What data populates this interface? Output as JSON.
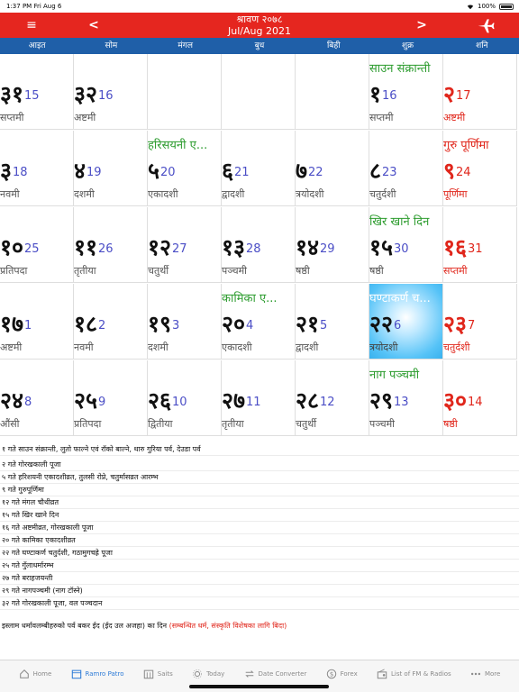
{
  "status_bar": {
    "time": "1:37 PM",
    "date": "Fri Aug 6",
    "battery": "100%"
  },
  "header": {
    "menu_label": "≡",
    "prev_label": "<",
    "next_label": ">",
    "title_np": "श्रावण २०७८",
    "title_en": "Jul/Aug 2021"
  },
  "weekdays": [
    "आइत",
    "सोम",
    "मंगल",
    "बुध",
    "बिही",
    "शुक्र",
    "शनि"
  ],
  "cells": [
    {
      "np": "३१",
      "en": "15",
      "tithi": "सप्तमी",
      "event": "",
      "red": false
    },
    {
      "np": "३२",
      "en": "16",
      "tithi": "अष्टमी",
      "event": "",
      "red": false
    },
    {
      "np": "",
      "en": "",
      "tithi": "",
      "event": "",
      "red": false
    },
    {
      "np": "",
      "en": "",
      "tithi": "",
      "event": "",
      "red": false
    },
    {
      "np": "",
      "en": "",
      "tithi": "",
      "event": "",
      "red": false
    },
    {
      "np": "१",
      "en": "16",
      "tithi": "सप्तमी",
      "event": "साउन संक्रान्ती",
      "red": false
    },
    {
      "np": "२",
      "en": "17",
      "tithi": "अष्टमी",
      "event": "",
      "red": true
    },
    {
      "np": "३",
      "en": "18",
      "tithi": "नवमी",
      "event": "",
      "red": false
    },
    {
      "np": "४",
      "en": "19",
      "tithi": "दशमी",
      "event": "",
      "red": false
    },
    {
      "np": "५",
      "en": "20",
      "tithi": "एकादशी",
      "event": "हरिसयनी ए...",
      "red": false
    },
    {
      "np": "६",
      "en": "21",
      "tithi": "द्वादशी",
      "event": "",
      "red": false
    },
    {
      "np": "७",
      "en": "22",
      "tithi": "त्रयोदशी",
      "event": "",
      "red": false
    },
    {
      "np": "८",
      "en": "23",
      "tithi": "चतुर्दशी",
      "event": "",
      "red": false
    },
    {
      "np": "९",
      "en": "24",
      "tithi": "पूर्णिमा",
      "event": "गुरु पूर्णिमा",
      "red": true
    },
    {
      "np": "१०",
      "en": "25",
      "tithi": "प्रतिपदा",
      "event": "",
      "red": false
    },
    {
      "np": "११",
      "en": "26",
      "tithi": "तृतीया",
      "event": "",
      "red": false
    },
    {
      "np": "१२",
      "en": "27",
      "tithi": "चतुर्थी",
      "event": "",
      "red": false
    },
    {
      "np": "१३",
      "en": "28",
      "tithi": "पञ्चमी",
      "event": "",
      "red": false
    },
    {
      "np": "१४",
      "en": "29",
      "tithi": "षष्ठी",
      "event": "",
      "red": false
    },
    {
      "np": "१५",
      "en": "30",
      "tithi": "षष्ठी",
      "event": "खिर खाने दिन",
      "red": false
    },
    {
      "np": "१६",
      "en": "31",
      "tithi": "सप्तमी",
      "event": "",
      "red": true
    },
    {
      "np": "१७",
      "en": "1",
      "tithi": "अष्टमी",
      "event": "",
      "red": false
    },
    {
      "np": "१८",
      "en": "2",
      "tithi": "नवमी",
      "event": "",
      "red": false
    },
    {
      "np": "१९",
      "en": "3",
      "tithi": "दशमी",
      "event": "",
      "red": false
    },
    {
      "np": "२०",
      "en": "4",
      "tithi": "एकादशी",
      "event": "कामिका ए...",
      "red": false
    },
    {
      "np": "२१",
      "en": "5",
      "tithi": "द्वादशी",
      "event": "",
      "red": false
    },
    {
      "np": "२२",
      "en": "6",
      "tithi": "त्रयोदशी",
      "event": "घण्टाकर्ण च...",
      "red": false,
      "today": true
    },
    {
      "np": "२३",
      "en": "7",
      "tithi": "चतुर्दशी",
      "event": "",
      "red": true
    },
    {
      "np": "२४",
      "en": "8",
      "tithi": "औंसी",
      "event": "",
      "red": false
    },
    {
      "np": "२५",
      "en": "9",
      "tithi": "प्रतिपदा",
      "event": "",
      "red": false
    },
    {
      "np": "२६",
      "en": "10",
      "tithi": "द्वितीया",
      "event": "",
      "red": false
    },
    {
      "np": "२७",
      "en": "11",
      "tithi": "तृतीया",
      "event": "",
      "red": false
    },
    {
      "np": "२८",
      "en": "12",
      "tithi": "चतुर्थी",
      "event": "",
      "red": false
    },
    {
      "np": "२९",
      "en": "13",
      "tithi": "पञ्चमी",
      "event": "नाग पञ्चमी",
      "red": false
    },
    {
      "np": "३०",
      "en": "14",
      "tithi": "षष्ठी",
      "event": "",
      "red": true
    }
  ],
  "notes": [
    "१ गते साउन संक्रान्ती, लुतो फाल्ने एवं रॉको बाल्ने, थारु गुरिया पर्व, देउडा पर्व",
    "२ गते गोरखकाली पूजा",
    "५ गते हरिशयनी एकादशीव्रत, तुलसी रोप्ने, चतुर्मासव्रत आरम्भ",
    "९ गते गुरुपूर्णिमा",
    "१२ गते मंगल चौथीव्रत",
    "१५ गते खिर खाने दिन",
    "१६ गते अष्टमीव्रत, गोरखकाली पूजा",
    "२० गते कामिका एकादशीव्रत",
    "२२ गते घण्टाकर्ण चतुर्दशी, गठामुगचह्रे पूजा",
    "२५ गते गुँलाधर्मारम्भ",
    "२७ गते बराहजयन्ती",
    "२९ गते नागपञ्चमी (नाग टॉस्ने)",
    "३२ गते गोरखकाली पूजा, वल पञ्चदान"
  ],
  "islam_note": {
    "text": "इस्लाम धर्मावलम्बीहरुको पर्व बकर ईद (ईद उल अजहा) का दिन",
    "highlight": "(सम्बन्धित धर्म, संस्कृति विशेषका लागि बिदा)"
  },
  "tabs": [
    {
      "label": "Home",
      "icon": "home-icon",
      "active": false
    },
    {
      "label": "Ramro Patro",
      "icon": "calendar-icon",
      "active": true
    },
    {
      "label": "Saits",
      "icon": "calendar-grid-icon",
      "active": false
    },
    {
      "label": "Today",
      "icon": "sun-icon",
      "active": false
    },
    {
      "label": "Date Converter",
      "icon": "swap-icon",
      "active": false
    },
    {
      "label": "Forex",
      "icon": "dollar-icon",
      "active": false
    },
    {
      "label": "List of FM & Radios",
      "icon": "radio-icon",
      "active": false
    },
    {
      "label": "More",
      "icon": "more-icon",
      "active": false
    }
  ],
  "colors": {
    "header_red": "#e5261f",
    "weekday_blue": "#1f5fa8",
    "event_green": "#2d9c2f",
    "holiday_red": "#e0261b",
    "en_date_blue": "#4b4ec6"
  }
}
